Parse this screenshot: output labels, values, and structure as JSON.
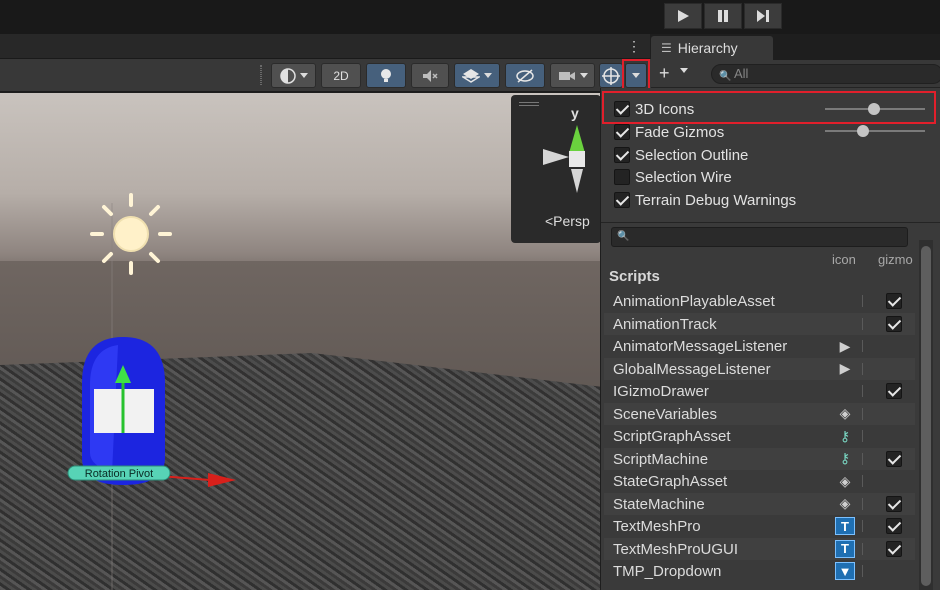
{
  "playbar": {
    "play_icon": "play-icon",
    "pause_icon": "pause-icon",
    "step_icon": "step-icon"
  },
  "hierarchy": {
    "tab_label": "Hierarchy",
    "search_placeholder": "All"
  },
  "scene_toolbar": {
    "twod_label": "2D",
    "icons": [
      "shading-mode-icon",
      "lighting-icon",
      "audio-mute-icon",
      "effects-icon",
      "hidden-objects-icon",
      "camera-icon",
      "gizmos-icon"
    ]
  },
  "gizmo": {
    "axis_label": "y",
    "projection_label": "<Persp"
  },
  "gizmo_menu": {
    "options": [
      {
        "label": "3D Icons",
        "checked": true,
        "slider": 0.6
      },
      {
        "label": "Fade Gizmos",
        "checked": true,
        "slider": 0.4
      },
      {
        "label": "Selection Outline",
        "checked": true
      },
      {
        "label": "Selection Wire",
        "checked": false
      },
      {
        "label": "Terrain Debug Warnings",
        "checked": true
      }
    ],
    "col_icon": "icon",
    "col_gizmo": "gizmo",
    "section_title": "Scripts",
    "scripts": [
      {
        "name": "AnimationPlayableAsset",
        "icon": "",
        "gizmo": true
      },
      {
        "name": "AnimationTrack",
        "icon": "",
        "gizmo": true
      },
      {
        "name": "AnimatorMessageListener",
        "icon": "listener-icon",
        "gizmo": false
      },
      {
        "name": "GlobalMessageListener",
        "icon": "listener-icon",
        "gizmo": false
      },
      {
        "name": "IGizmoDrawer",
        "icon": "",
        "gizmo": true
      },
      {
        "name": "SceneVariables",
        "icon": "variables-icon",
        "gizmo": false
      },
      {
        "name": "ScriptGraphAsset",
        "icon": "graph-icon",
        "gizmo": false
      },
      {
        "name": "ScriptMachine",
        "icon": "graph-icon",
        "gizmo": true
      },
      {
        "name": "StateGraphAsset",
        "icon": "state-icon",
        "gizmo": false
      },
      {
        "name": "StateMachine",
        "icon": "state-icon",
        "gizmo": true
      },
      {
        "name": "TextMeshPro",
        "icon": "textmeshpro-icon",
        "gizmo": true
      },
      {
        "name": "TextMeshProUGUI",
        "icon": "textmeshpro-icon",
        "gizmo": true
      },
      {
        "name": "TMP_Dropdown",
        "icon": "dropdown-icon",
        "gizmo": false
      }
    ]
  },
  "scene": {
    "pivot_label": "Rotation Pivot"
  },
  "colors": {
    "accent_red": "#e11f2b",
    "active_blue": "#46607c"
  }
}
